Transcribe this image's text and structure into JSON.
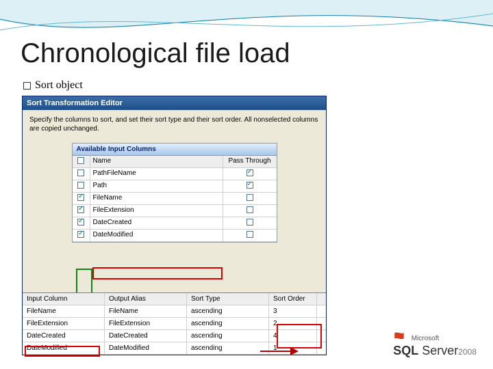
{
  "title": "Chronological file load",
  "bullet": "Sort object",
  "editor": {
    "window_title": "Sort Transformation Editor",
    "description": "Specify the columns to sort, and set their sort type and their sort order. All nonselected columns are copied unchanged.",
    "available_header": "Available Input Columns",
    "col_name_header": "Name",
    "col_pass_header": "Pass Through",
    "rows": [
      {
        "checked": false,
        "name": "PathFileName",
        "pass": true
      },
      {
        "checked": false,
        "name": "Path",
        "pass": true
      },
      {
        "checked": true,
        "name": "FileName",
        "pass": false
      },
      {
        "checked": true,
        "name": "FileExtension",
        "pass": false
      },
      {
        "checked": true,
        "name": "DateCreated",
        "pass": false
      },
      {
        "checked": true,
        "name": "DateModified",
        "pass": false
      }
    ]
  },
  "grid": {
    "headers": {
      "c1": "Input Column",
      "c2": "Output Alias",
      "c3": "Sort Type",
      "c4": "Sort Order"
    },
    "rows": [
      {
        "c1": "FileName",
        "c2": "FileName",
        "c3": "ascending",
        "c4": "3"
      },
      {
        "c1": "FileExtension",
        "c2": "FileExtension",
        "c3": "ascending",
        "c4": "2"
      },
      {
        "c1": "DateCreated",
        "c2": "DateCreated",
        "c3": "ascending",
        "c4": "4"
      },
      {
        "c1": "DateModified",
        "c2": "DateModified",
        "c3": "ascending",
        "c4": "1"
      }
    ]
  },
  "logo": {
    "vendor": "Microsoft",
    "product_a": "SQL",
    "product_b": "Server",
    "year": "2008"
  }
}
